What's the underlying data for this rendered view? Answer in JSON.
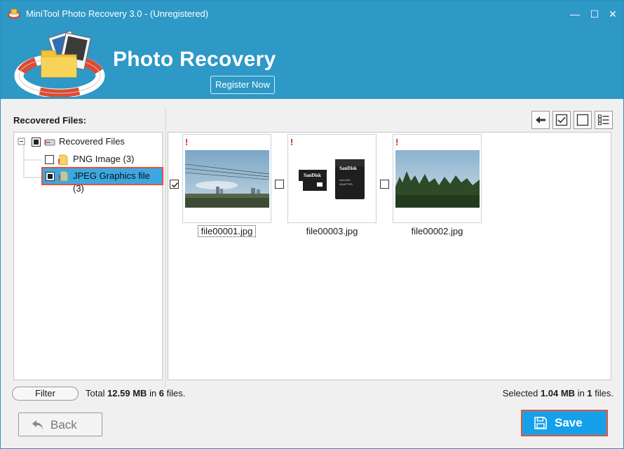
{
  "window": {
    "title": "MiniTool Photo Recovery 3.0 - (Unregistered)",
    "controls": {
      "minimize": "—",
      "maximize": "☐",
      "close": "✕"
    }
  },
  "banner": {
    "heading": "Photo Recovery",
    "register_label": "Register Now",
    "accent": "#2e98c7"
  },
  "left": {
    "label": "Recovered Files:",
    "tree": [
      {
        "label": "Recovered Files",
        "level": 0,
        "check": "partial",
        "icon": "drive-icon",
        "expanded": true
      },
      {
        "label": "PNG Image (3)",
        "level": 1,
        "check": "unchecked",
        "icon": "file-warning-icon"
      },
      {
        "label": "JPEG Graphics file (3)",
        "level": 1,
        "check": "partial",
        "icon": "file-warning-icon",
        "selected": true
      }
    ]
  },
  "toolbar": {
    "icons": [
      "back-arrow-icon",
      "check-all-icon",
      "uncheck-all-icon",
      "list-view-icon"
    ]
  },
  "files": [
    {
      "name": "file00001.jpg",
      "checked": true,
      "focused": true,
      "warning": "!",
      "thumb": "city-skyline-thumbnail"
    },
    {
      "name": "file00003.jpg",
      "checked": false,
      "focused": false,
      "warning": "!",
      "thumb": "sandisk-cards-thumbnail"
    },
    {
      "name": "file00002.jpg",
      "checked": false,
      "focused": false,
      "warning": "!",
      "thumb": "forest-treeline-thumbnail"
    }
  ],
  "status": {
    "filter_label": "Filter",
    "total_prefix": "Total ",
    "total_size": "12.59 MB",
    "total_mid": " in ",
    "total_count": "6",
    "total_suffix": " files.",
    "selected_prefix": "Selected ",
    "selected_size": "1.04 MB",
    "selected_mid": " in ",
    "selected_count": "1",
    "selected_suffix": " files."
  },
  "footer": {
    "back_label": "Back",
    "save_label": "Save"
  }
}
